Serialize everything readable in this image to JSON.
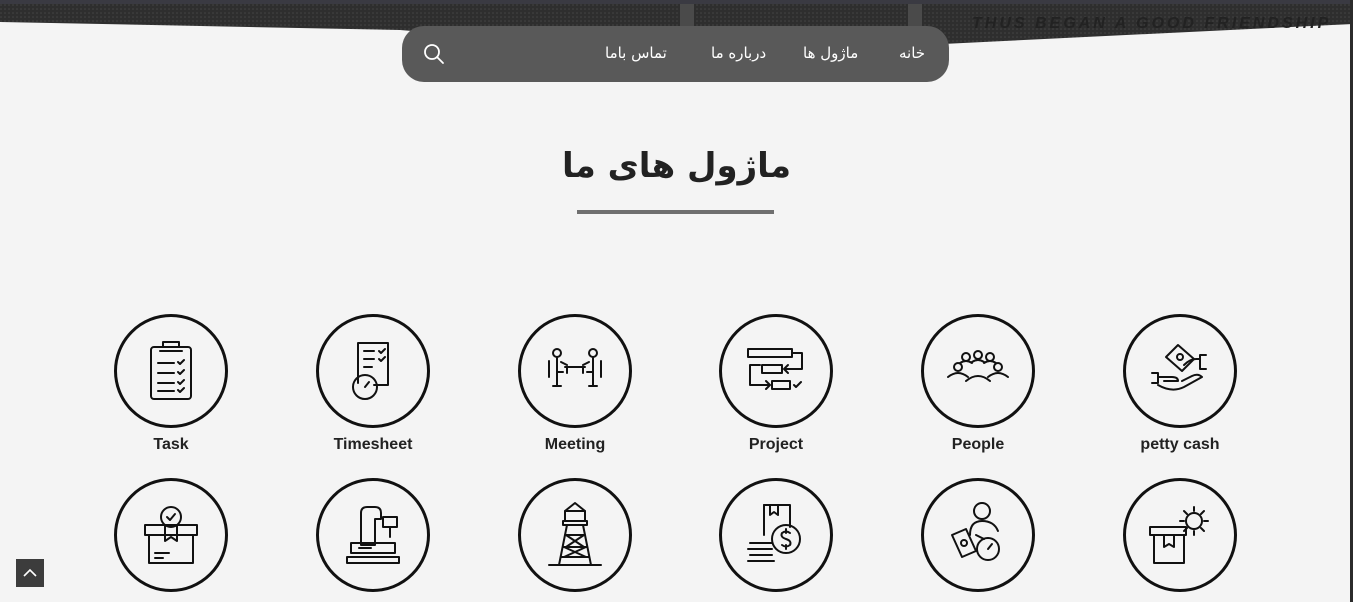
{
  "hero": {
    "banner_text": "THUS BEGAN A GOOD FRIENDSHIP"
  },
  "nav": {
    "items": [
      {
        "label": "خانه",
        "name": "nav-home"
      },
      {
        "label": "ماژول ها",
        "name": "nav-modules"
      },
      {
        "label": "درباره ما",
        "name": "nav-about"
      },
      {
        "label": "تماس باما",
        "name": "nav-contact"
      }
    ],
    "search_icon": "search-icon"
  },
  "section": {
    "title": "ماژول های ما"
  },
  "modules_row1": [
    {
      "label": "Task",
      "icon": "clipboard-checklist-icon"
    },
    {
      "label": "Timesheet",
      "icon": "timesheet-clock-icon"
    },
    {
      "label": "Meeting",
      "icon": "meeting-table-icon"
    },
    {
      "label": "Project",
      "icon": "project-flow-icon"
    },
    {
      "label": "People",
      "icon": "people-group-icon"
    },
    {
      "label": "petty cash",
      "icon": "cash-hand-icon"
    }
  ],
  "modules_row2": [
    {
      "label": "",
      "icon": "certificate-box-icon"
    },
    {
      "label": "",
      "icon": "cash-register-icon"
    },
    {
      "label": "",
      "icon": "watchtower-icon"
    },
    {
      "label": "",
      "icon": "money-coins-icon"
    },
    {
      "label": "",
      "icon": "person-payroll-icon"
    },
    {
      "label": "",
      "icon": "box-gear-icon"
    }
  ],
  "colors": {
    "nav_bg": "#595959",
    "page_bg": "#f4f4f4",
    "ink": "#111111",
    "rule": "#6f6f6f"
  },
  "scroll_top_icon": "chevron-up-icon"
}
